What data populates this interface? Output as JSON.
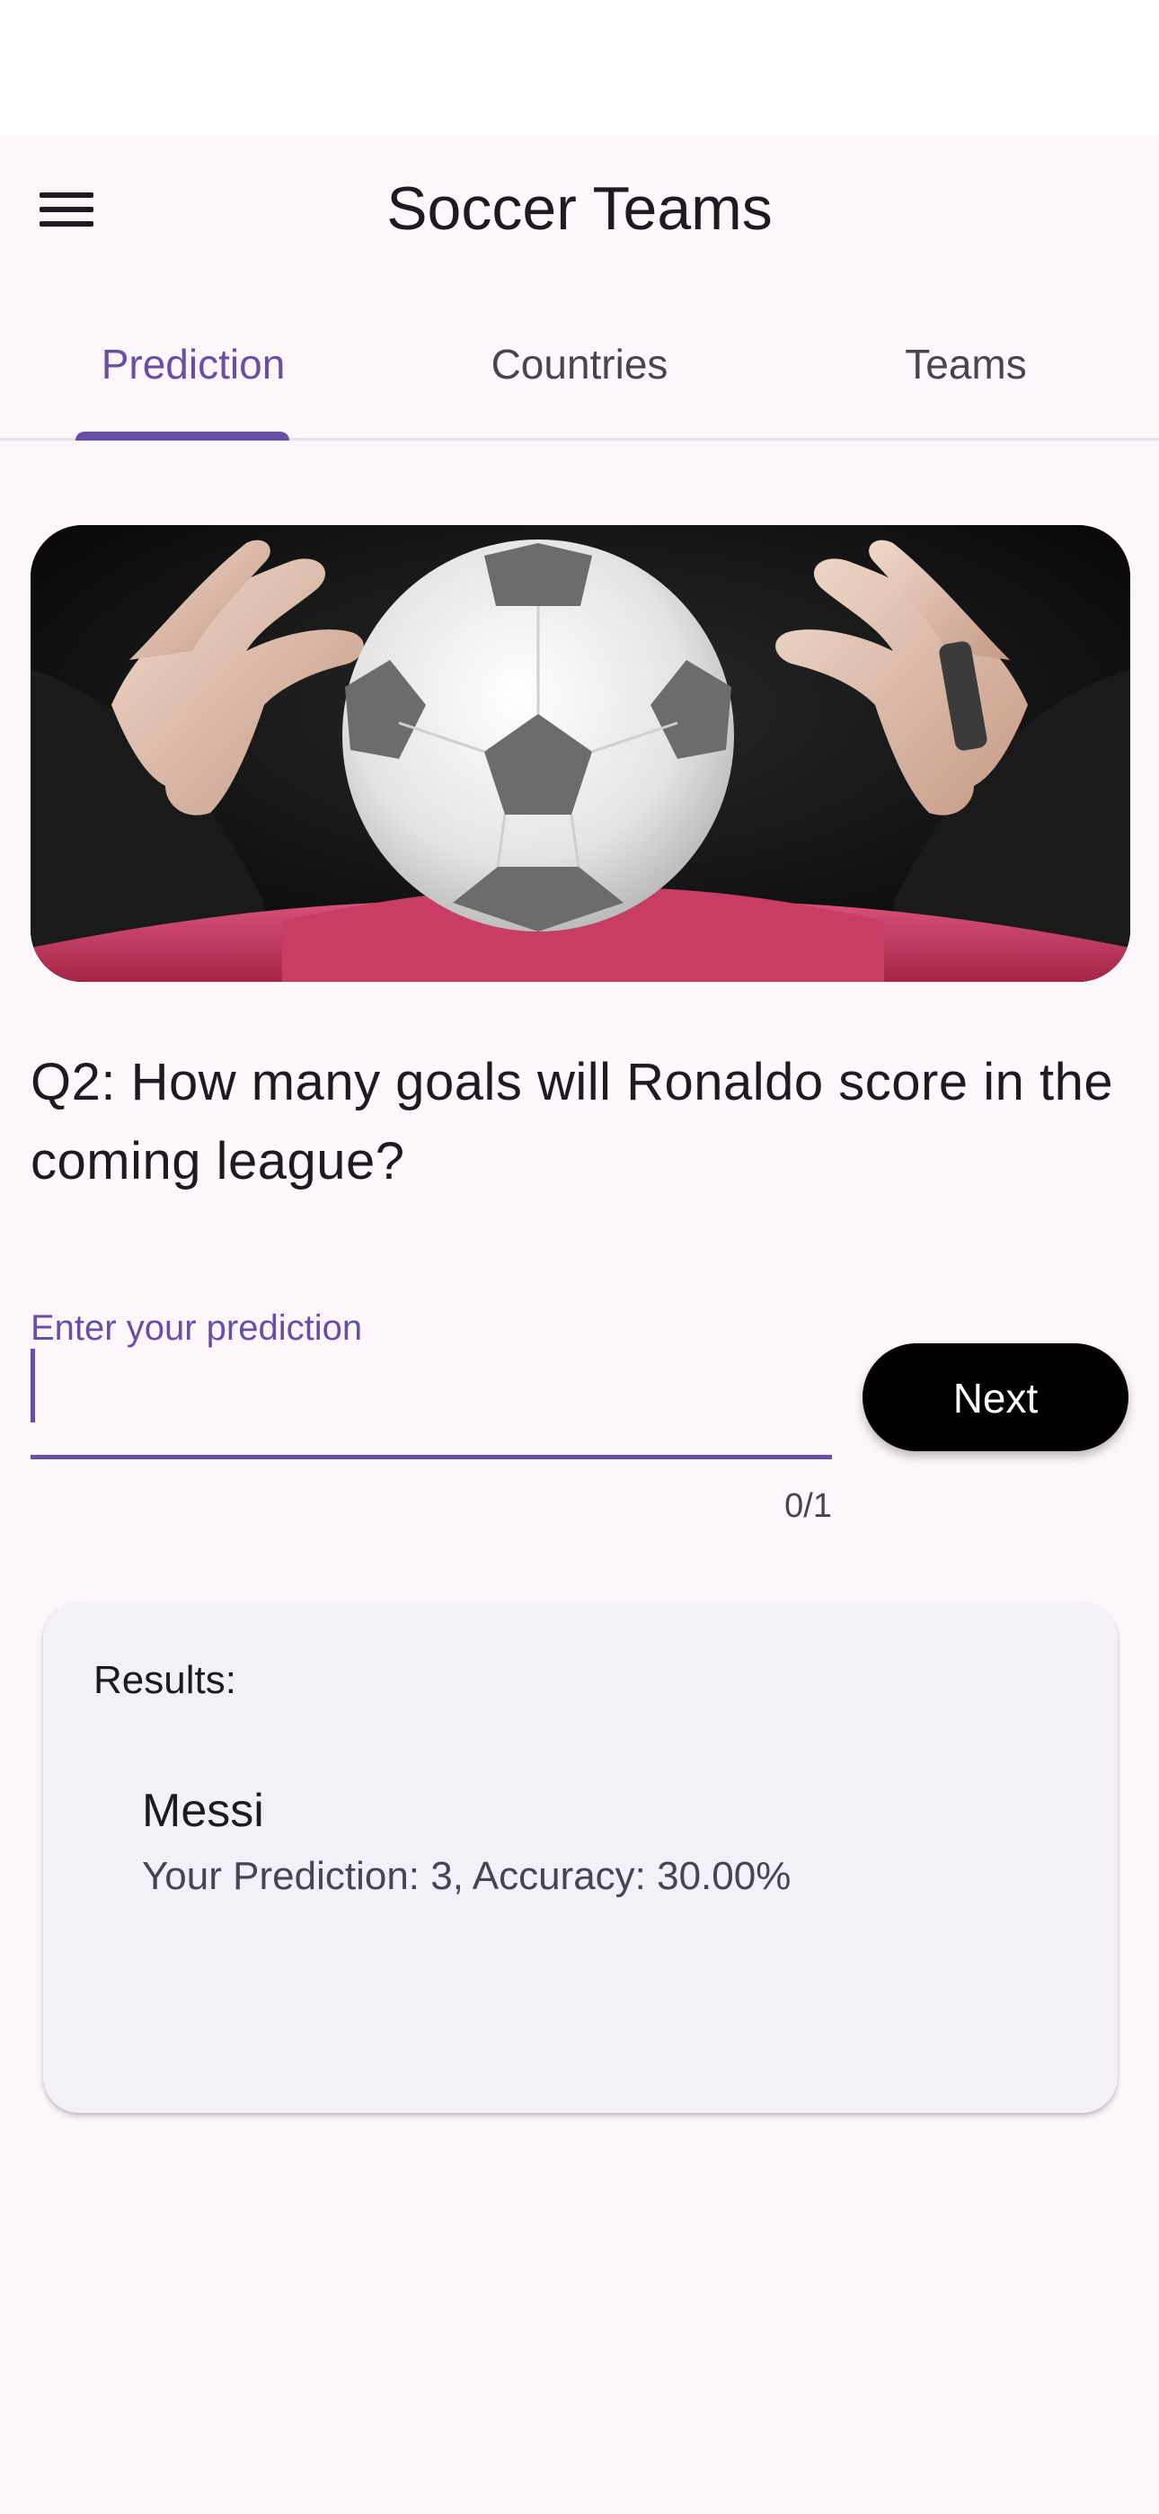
{
  "app_bar": {
    "title": "Soccer Teams",
    "menu_icon": "menu-icon"
  },
  "tabs": [
    {
      "label": "Prediction",
      "active": true
    },
    {
      "label": "Countries",
      "active": false
    },
    {
      "label": "Teams",
      "active": false
    }
  ],
  "question": {
    "text": "Q2: How many goals will Ronaldo score in the coming league?"
  },
  "prediction_input": {
    "label": "Enter your prediction",
    "value": "",
    "counter": "0/1"
  },
  "next_button": {
    "label": "Next"
  },
  "results": {
    "title": "Results:",
    "items": [
      {
        "name": "Messi",
        "detail": "Your Prediction: 3, Accuracy: 30.00%"
      }
    ]
  },
  "colors": {
    "accent": "#6750A4",
    "background": "#FDF7FB",
    "card": "#F4F0F7",
    "button": "#000000"
  }
}
